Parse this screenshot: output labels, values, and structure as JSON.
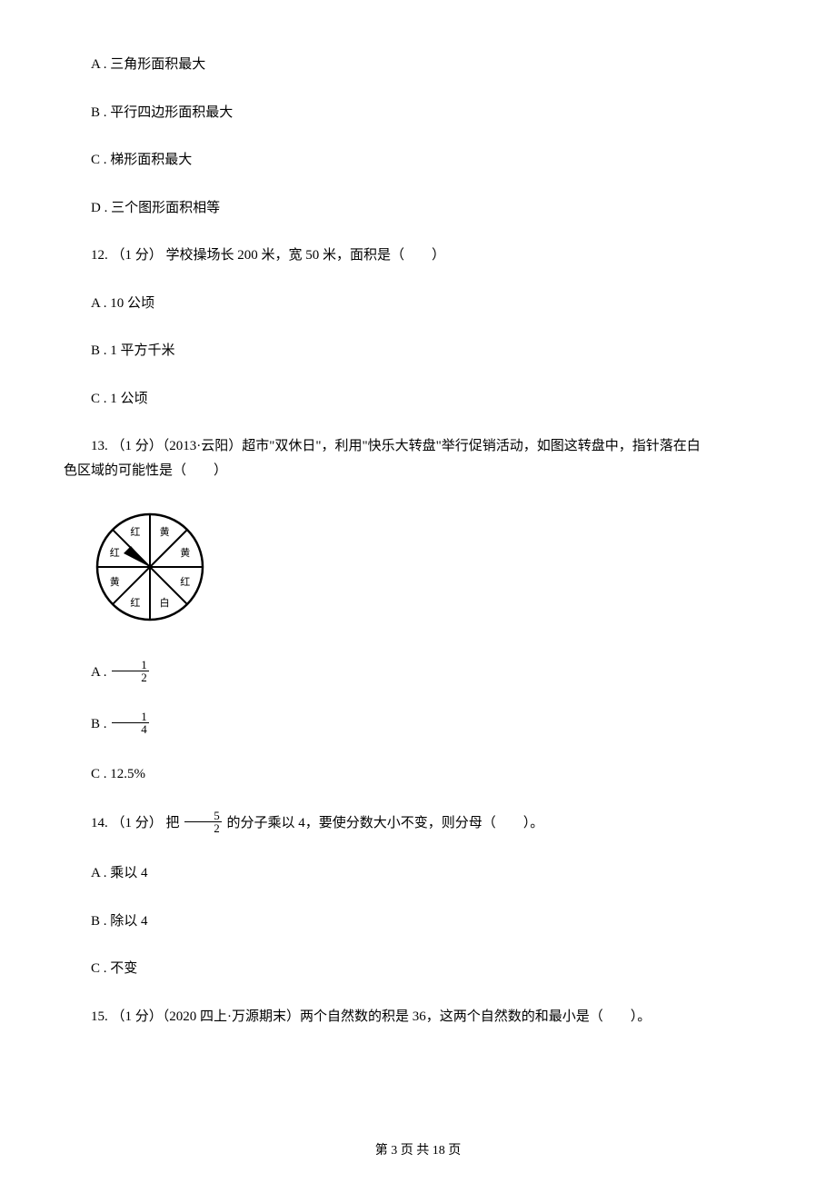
{
  "q11": {
    "optA": "A . 三角形面积最大",
    "optB": "B . 平行四边形面积最大",
    "optC": "C . 梯形面积最大",
    "optD": "D . 三个图形面积相等"
  },
  "q12": {
    "stem": "12. （1 分） 学校操场长 200 米，宽 50 米，面积是（　　）",
    "optA": "A . 10 公顷",
    "optB": "B . 1 平方千米",
    "optC": "C . 1 公顷"
  },
  "q13": {
    "stem_l1": "13. （1 分）（2013·云阳）超市\"双休日\"，利用\"快乐大转盘\"举行促销活动，如图这转盘中，指针落在白",
    "stem_l2": "色区域的可能性是（　　）",
    "slices": [
      "红",
      "黄",
      "黄",
      "红",
      "白",
      "红",
      "黄",
      "红"
    ],
    "optA_prefix": "A . ",
    "optA_num": "1",
    "optA_den": "2",
    "optB_prefix": "B . ",
    "optB_num": "1",
    "optB_den": "4",
    "optC": "C . 12.5%"
  },
  "q14": {
    "prefix": "14. （1 分） 把 ",
    "num": "5",
    "den": "2",
    "suffix": " 的分子乘以 4，要使分数大小不变，则分母（　　）。",
    "optA": "A . 乘以 4",
    "optB": "B . 除以 4",
    "optC": "C . 不变"
  },
  "q15": {
    "stem": "15. （1 分）（2020 四上·万源期末）两个自然数的积是 36，这两个自然数的和最小是（　　）。"
  },
  "footer": "第 3 页 共 18 页"
}
